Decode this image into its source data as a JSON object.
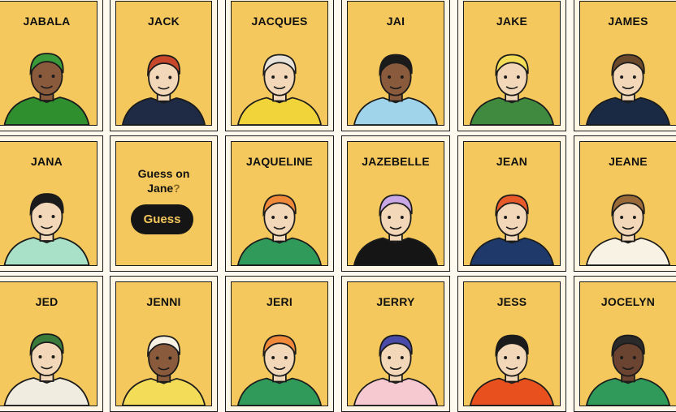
{
  "guess_panel": {
    "prompt_line1": "Guess on",
    "prompt_name": "Jane",
    "prompt_mark": "?",
    "button_label": "Guess"
  },
  "characters": [
    {
      "name": "JABALA",
      "skin": "#8a5a3c",
      "hair": "#3a9a3a",
      "shirt": "#2f8f2f",
      "icon": "hijab-portrait-icon"
    },
    {
      "name": "JACK",
      "skin": "#f2d7b8",
      "hair": "#c8472a",
      "shirt": "#1f2a44",
      "icon": "pirate-portrait-icon"
    },
    {
      "name": "JACQUES",
      "skin": "#f2d7b8",
      "hair": "#e8e3da",
      "shirt": "#f1d43a",
      "icon": "fisherman-portrait-icon"
    },
    {
      "name": "JAI",
      "skin": "#8a5a3c",
      "hair": "#1b1b1b",
      "shirt": "#9fd4ea",
      "icon": "man-tie-portrait-icon"
    },
    {
      "name": "JAKE",
      "skin": "#f2d7b8",
      "hair": "#f3dc58",
      "shirt": "#3f8a3f",
      "icon": "blond-glasses-portrait-icon"
    },
    {
      "name": "JAMES",
      "skin": "#f2d7b8",
      "hair": "#6b4a2c",
      "shirt": "#1b2a44",
      "icon": "sunglasses-portrait-icon"
    },
    {
      "name": "JANA",
      "skin": "#f2d7b8",
      "hair": "#1b1b1b",
      "shirt": "#a8e0c8",
      "icon": "sunglasses-portrait-icon"
    },
    {
      "name": "JAQUELINE",
      "skin": "#f2d7b8",
      "hair": "#f08a3a",
      "shirt": "#2f9a5a",
      "icon": "pearls-portrait-icon"
    },
    {
      "name": "JAZEBELLE",
      "skin": "#f2d7b8",
      "hair": "#c9a8e6",
      "shirt": "#151515",
      "icon": "lilac-hair-portrait-icon"
    },
    {
      "name": "JEAN",
      "skin": "#f2d7b8",
      "hair": "#e85a2a",
      "shirt": "#1f3a6a",
      "icon": "beanie-portrait-icon"
    },
    {
      "name": "JEANE",
      "skin": "#f2d7b8",
      "hair": "#9a6a3a",
      "shirt": "#f7f2e3",
      "icon": "glasses-woman-portrait-icon"
    },
    {
      "name": "JED",
      "skin": "#f2d7b8",
      "hair": "#3a7a3a",
      "shirt": "#f0ece0",
      "icon": "beard-beanie-portrait-icon"
    },
    {
      "name": "JENNI",
      "skin": "#8a5a3c",
      "hair": "#f7f2e3",
      "shirt": "#f3dc58",
      "icon": "sunhat-portrait-icon"
    },
    {
      "name": "JERI",
      "skin": "#f2d7b8",
      "hair": "#f08a3a",
      "shirt": "#2f9a5a",
      "icon": "bun-glasses-portrait-icon"
    },
    {
      "name": "JERRY",
      "skin": "#f2d7b8",
      "hair": "#4a4aa8",
      "shirt": "#f6c8d0",
      "icon": "cap-portrait-icon"
    },
    {
      "name": "JESS",
      "skin": "#f2d7b8",
      "hair": "#1b1b1b",
      "shirt": "#e8501e",
      "icon": "bob-hair-portrait-icon"
    },
    {
      "name": "JOCELYN",
      "skin": "#6a4430",
      "hair": "#2a2a2a",
      "shirt": "#2f9a5a",
      "icon": "bun-portrait-icon"
    }
  ]
}
